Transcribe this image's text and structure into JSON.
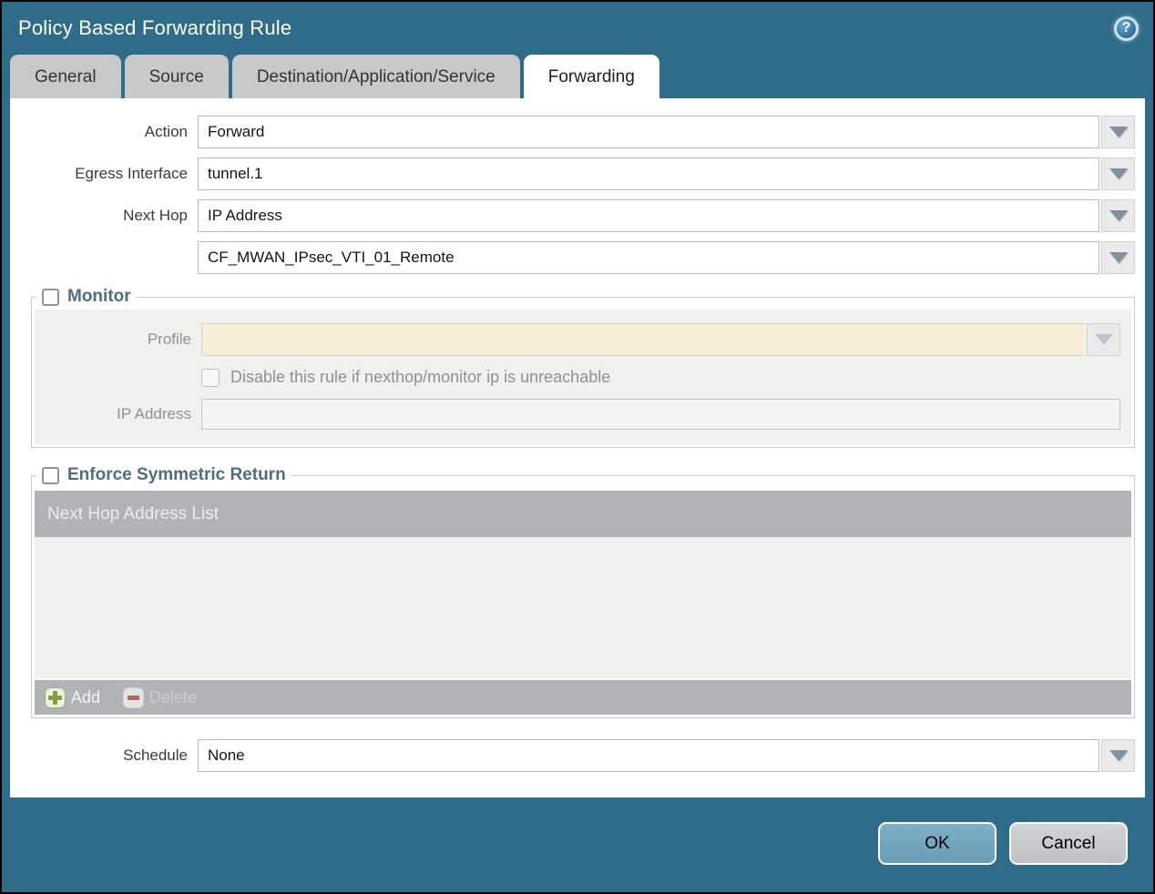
{
  "window": {
    "title": "Policy Based Forwarding Rule"
  },
  "titlebar": {
    "help_glyph": "?"
  },
  "tabs": [
    {
      "label": "General",
      "active": false
    },
    {
      "label": "Source",
      "active": false
    },
    {
      "label": "Destination/Application/Service",
      "active": false
    },
    {
      "label": "Forwarding",
      "active": true
    }
  ],
  "form": {
    "action_label": "Action",
    "action_value": "Forward",
    "egress_label": "Egress Interface",
    "egress_value": "tunnel.1",
    "next_hop_label": "Next Hop",
    "next_hop_value": "IP Address",
    "next_hop_address": "CF_MWAN_IPsec_VTI_01_Remote",
    "schedule_label": "Schedule",
    "schedule_value": "None"
  },
  "monitor": {
    "legend": "Monitor",
    "checked": false,
    "profile_label": "Profile",
    "profile_value": "",
    "disable_label": "Disable this rule if nexthop/monitor ip is unreachable",
    "disable_checked": false,
    "ip_label": "IP Address",
    "ip_value": ""
  },
  "symmetric": {
    "legend": "Enforce Symmetric Return",
    "checked": false,
    "list_header": "Next Hop Address List",
    "rows": [],
    "add_label": "Add",
    "delete_label": "Delete"
  },
  "footer": {
    "ok_label": "OK",
    "cancel_label": "Cancel"
  },
  "colors": {
    "accent_teal": "#2f6c8a",
    "tab_inactive": "#c9c9c9",
    "bar_gray": "#b0b4b7",
    "profile_cream": "#f6eed9",
    "ok_blue": "#73a6be",
    "add_green": "#7ba13c",
    "delete_red": "#b0695f",
    "legend_text": "#4f6f80"
  }
}
